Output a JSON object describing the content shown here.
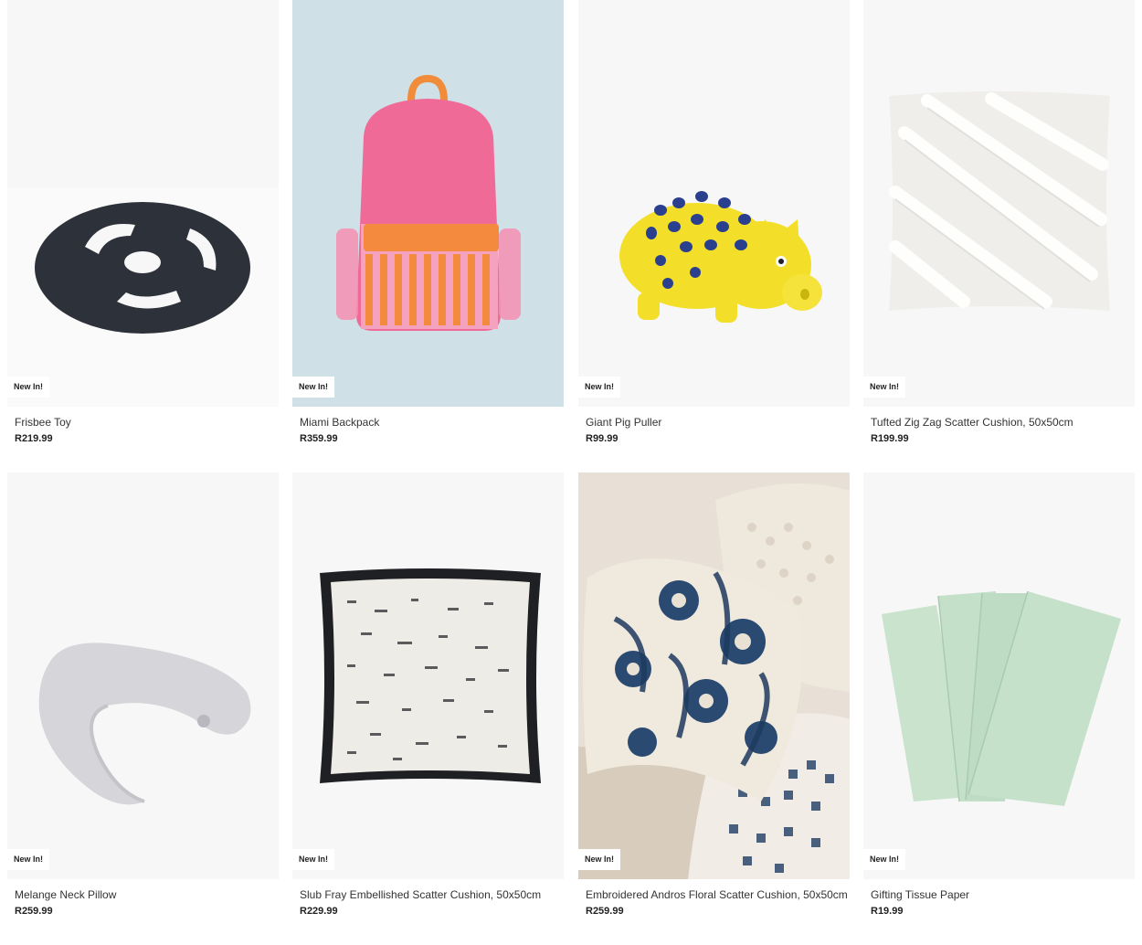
{
  "products": [
    {
      "name": "Frisbee Toy",
      "price": "R219.99",
      "badge": "New In!",
      "image": "frisbee-toy-image"
    },
    {
      "name": "Miami Backpack",
      "price": "R359.99",
      "badge": "New In!",
      "image": "backpack-image"
    },
    {
      "name": "Giant Pig Puller",
      "price": "R99.99",
      "badge": "New In!",
      "image": "pig-toy-image"
    },
    {
      "name": "Tufted Zig Zag Scatter Cushion, 50x50cm",
      "price": "R199.99",
      "badge": "New In!",
      "image": "tufted-cushion-image"
    },
    {
      "name": "Melange Neck Pillow",
      "price": "R259.99",
      "badge": "New In!",
      "image": "neck-pillow-image"
    },
    {
      "name": "Slub Fray Embellished Scatter Cushion, 50x50cm",
      "price": "R229.99",
      "badge": "New In!",
      "image": "fray-cushion-image"
    },
    {
      "name": "Embroidered Andros Floral Scatter Cushion, 50x50cm",
      "price": "R259.99",
      "badge": "New In!",
      "image": "floral-cushion-image"
    },
    {
      "name": "Gifting Tissue Paper",
      "price": "R19.99",
      "badge": "New In!",
      "image": "tissue-paper-image"
    }
  ]
}
